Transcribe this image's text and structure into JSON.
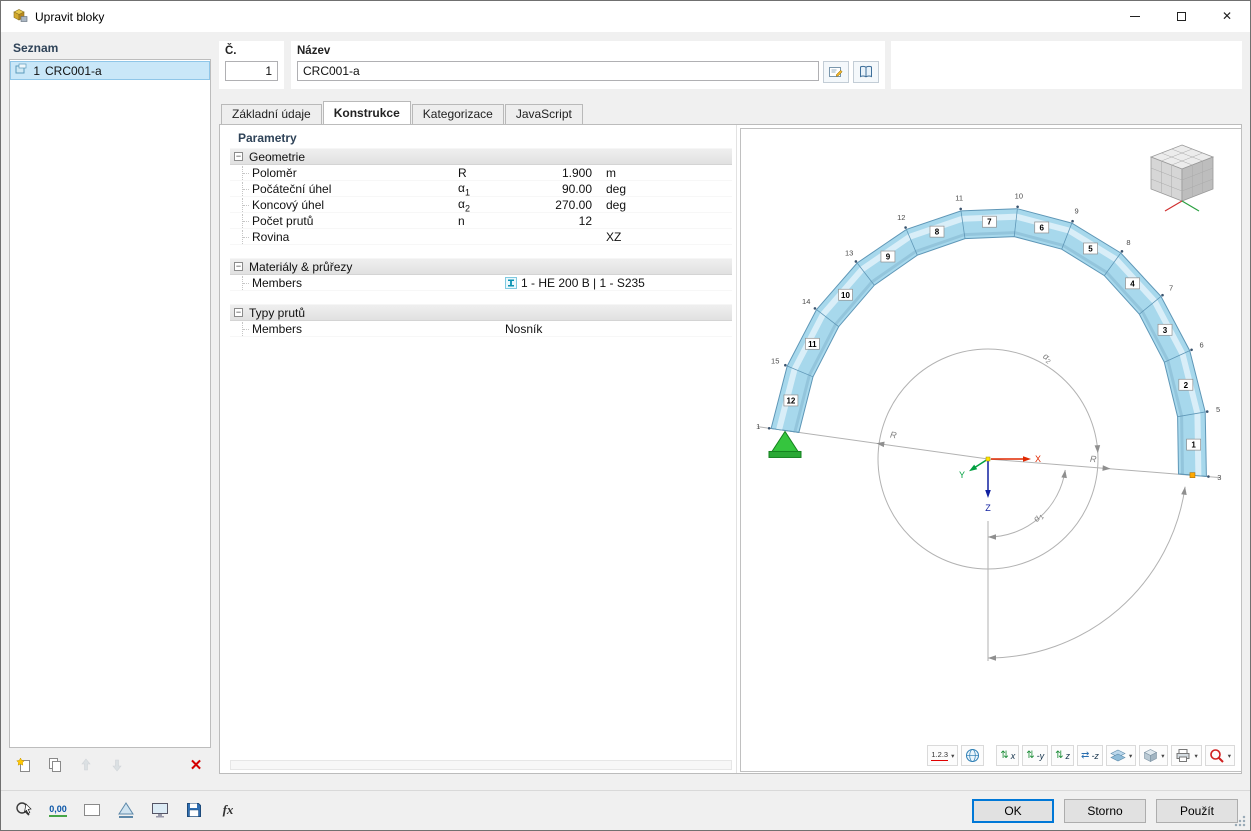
{
  "window": {
    "title": "Upravit bloky"
  },
  "icons": {
    "close": "✕",
    "caret": "▾",
    "collapse": "−",
    "delete": "✕",
    "updown": "⇅",
    "leftright": "⇄"
  },
  "sidebar": {
    "header": "Seznam",
    "items": [
      {
        "index": "1",
        "name": "CRC001-a",
        "selected": true
      }
    ]
  },
  "header": {
    "number_label": "Č.",
    "number_value": "1",
    "name_label": "Název",
    "name_value": "CRC001-a"
  },
  "tabs": [
    {
      "label": "Základní údaje",
      "active": false
    },
    {
      "label": "Konstrukce",
      "active": true
    },
    {
      "label": "Kategorizace",
      "active": false
    },
    {
      "label": "JavaScript",
      "active": false
    }
  ],
  "parameters": {
    "title": "Parametry",
    "groups": [
      {
        "label": "Geometrie",
        "rows": [
          {
            "name": "Poloměr",
            "symbol": "R",
            "sub": "",
            "value": "1.900",
            "unit": "m",
            "align": "right"
          },
          {
            "name": "Počáteční úhel",
            "symbol": "α",
            "sub": "1",
            "value": "90.00",
            "unit": "deg",
            "align": "right"
          },
          {
            "name": "Koncový úhel",
            "symbol": "α",
            "sub": "2",
            "value": "270.00",
            "unit": "deg",
            "align": "right"
          },
          {
            "name": "Počet prutů",
            "symbol": "n",
            "sub": "",
            "value": "12",
            "unit": "",
            "align": "right"
          },
          {
            "name": "Rovina",
            "symbol": "",
            "sub": "",
            "value": "XZ",
            "unit": "",
            "align": "unit"
          }
        ]
      },
      {
        "label": "Materiály & průřezy",
        "rows": [
          {
            "name": "Members",
            "symbol": "",
            "sub": "",
            "value": "1 - HE 200 B | 1 - S235",
            "unit": "",
            "align": "left",
            "icon": "section-icon"
          }
        ]
      },
      {
        "label": "Typy prutů",
        "rows": [
          {
            "name": "Members",
            "symbol": "",
            "sub": "",
            "value": "Nosník",
            "unit": "",
            "align": "left"
          }
        ]
      }
    ]
  },
  "viewport": {
    "member_numbers": [
      "12",
      "11",
      "10",
      "9",
      "8",
      "7",
      "6",
      "5",
      "4",
      "3",
      "2",
      "1"
    ],
    "node_numbers": [
      "1",
      "15",
      "14",
      "13",
      "12",
      "11",
      "10",
      "9",
      "8",
      "7",
      "6",
      "5",
      "3"
    ],
    "labels": {
      "radius_left": "R",
      "radius_right": "R",
      "alpha1": "α1",
      "alpha2": "α2",
      "axis_x": "X",
      "axis_y": "Y",
      "axis_z": "Z"
    },
    "toolbar": {
      "numbering": "1.2.3",
      "axis_x": "x",
      "axis_neg_y": "-y",
      "axis_z": "z",
      "axis_neg_z": "-z"
    }
  },
  "statusbar": {
    "decimal": "0,00",
    "formula": "fx"
  },
  "footer": {
    "ok": "OK",
    "cancel": "Storno",
    "apply": "Použít"
  }
}
